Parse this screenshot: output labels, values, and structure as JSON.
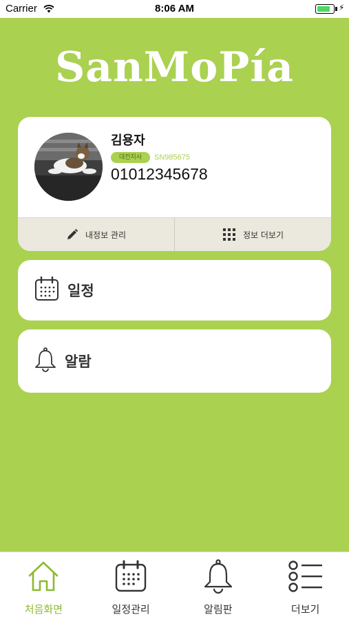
{
  "status_bar": {
    "carrier": "Carrier",
    "time": "8:06 AM",
    "battery_level": 0.85
  },
  "app": {
    "logo_text": "SanMoPía"
  },
  "profile": {
    "name": "김용자",
    "branch": "대전지사",
    "serial": "SN985675",
    "phone": "01012345678",
    "edit_label": "내정보 관리",
    "more_label": "정보 더보기"
  },
  "menu": {
    "schedule_label": "일정",
    "alarm_label": "알람"
  },
  "tabs": [
    {
      "label": "처음화면",
      "icon": "home-icon",
      "active": true
    },
    {
      "label": "일정관리",
      "icon": "calendar-icon",
      "active": false
    },
    {
      "label": "알림판",
      "icon": "bell-icon",
      "active": false
    },
    {
      "label": "더보기",
      "icon": "list-icon",
      "active": false
    }
  ],
  "colors": {
    "background": "#aad150",
    "accent": "#8bbb2e",
    "action_bar": "#ebe8dd"
  }
}
